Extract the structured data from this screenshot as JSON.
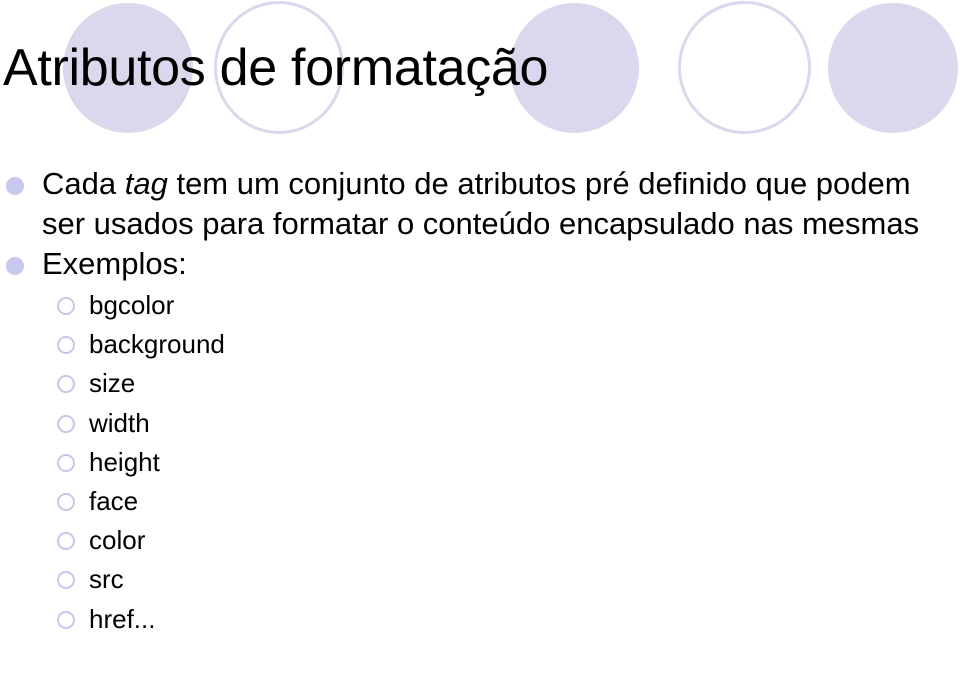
{
  "decoration": {
    "circles": [
      "filled",
      "ring",
      "filled",
      "ring",
      "filled"
    ],
    "accent_color": "#d9d8ec"
  },
  "slide": {
    "title": "Atributos de formatação",
    "bullets": [
      {
        "pre": "Cada ",
        "emph": "tag",
        "post": " tem um conjunto de atributos pré definido que podem ser usados para formatar o conteúdo encapsulado nas mesmas"
      },
      {
        "text": "Exemplos:",
        "sub_items": [
          "bgcolor",
          "background",
          "size",
          "width",
          "height",
          "face",
          "color",
          "src",
          "href..."
        ]
      }
    ]
  }
}
